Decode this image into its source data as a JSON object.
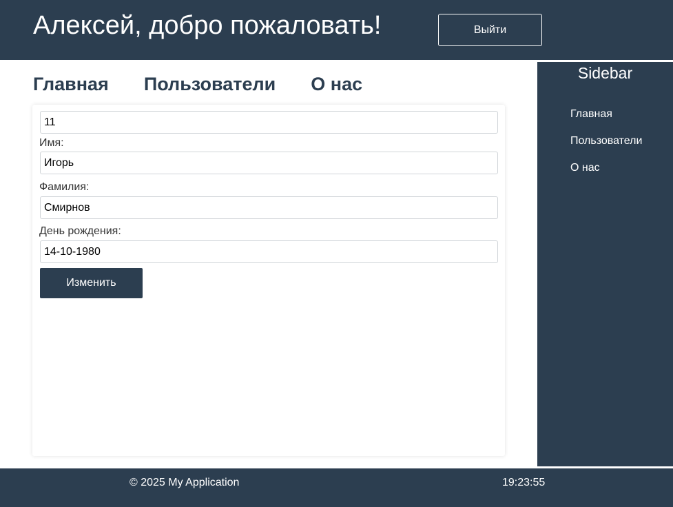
{
  "header": {
    "title": "Алексей, добро пожаловать!",
    "logout_label": "Выйти"
  },
  "nav": {
    "items": [
      {
        "label": "Главная"
      },
      {
        "label": "Пользователи"
      },
      {
        "label": "О нас"
      }
    ]
  },
  "form": {
    "id_value": "11",
    "first_name_label": "Имя:",
    "first_name_value": "Игорь",
    "last_name_label": "Фамилия:",
    "last_name_value": "Смирнов",
    "birthday_label": "День рождения:",
    "birthday_value": "14-10-1980",
    "submit_label": "Изменить"
  },
  "sidebar": {
    "title": "Sidebar",
    "items": [
      {
        "label": "Главная"
      },
      {
        "label": "Пользователи"
      },
      {
        "label": "О нас"
      }
    ]
  },
  "footer": {
    "copyright": "© 2025 My Application",
    "time": "19:23:55"
  },
  "colors": {
    "primary": "#2c3e50",
    "background": "#ffffff"
  }
}
